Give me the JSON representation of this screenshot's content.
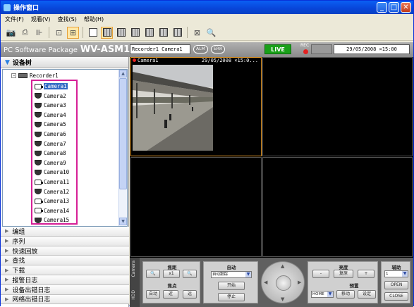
{
  "window": {
    "title": "操作窗口",
    "min_btn": "_",
    "max_btn": "□",
    "close_btn": "✕"
  },
  "menu": [
    "文件(F)",
    "观看(V)",
    "查找(S)",
    "帮助(H)"
  ],
  "infobar": {
    "brand_prefix": "PC Software Package",
    "brand_model": "WV-ASM100",
    "recorder_camera": "Recorder1 Camera1",
    "alm": "ALM",
    "err": "ERR",
    "live": "LIVE",
    "rec": "REC",
    "datetime": "29/05/2008 ×15:00"
  },
  "tree": {
    "header": "设备树",
    "recorder": "Recorder1",
    "cameras": [
      {
        "label": "Camera1",
        "type": "fixed",
        "selected": true
      },
      {
        "label": "Camera2",
        "type": "dome"
      },
      {
        "label": "Camera3",
        "type": "dome"
      },
      {
        "label": "Camera4",
        "type": "dome"
      },
      {
        "label": "Camera5",
        "type": "dome"
      },
      {
        "label": "Camera6",
        "type": "dome"
      },
      {
        "label": "Camera7",
        "type": "dome"
      },
      {
        "label": "Camera8",
        "type": "dome"
      },
      {
        "label": "Camera9",
        "type": "dome"
      },
      {
        "label": "Camera10",
        "type": "dome"
      },
      {
        "label": "Camera11",
        "type": "fixed"
      },
      {
        "label": "Camera12",
        "type": "dome"
      },
      {
        "label": "Camera13",
        "type": "fixed"
      },
      {
        "label": "Camera14",
        "type": "fixed"
      },
      {
        "label": "Camera15",
        "type": "dome"
      }
    ]
  },
  "sections": [
    "编组",
    "序列",
    "快速回放",
    "查找",
    "下载",
    "报警日志",
    "设备出错日志",
    "网络出错日志"
  ],
  "video": {
    "cam_label": "Camera1",
    "cam_time": "29/05/2008 ×15:0..."
  },
  "controls": {
    "tab_camera": "Camera",
    "tab_hdd": "HDD",
    "zoom_label": "焦距",
    "zoom_x1": "x1",
    "focus_label": "焦点",
    "focus_auto": "自动",
    "focus_near": "近",
    "focus_far": "远",
    "auto_label": "自动",
    "auto_select": "自动跟踪",
    "auto_start": "开始",
    "auto_stop": "停止",
    "brightness_label": "亮度",
    "brightness_minus": "-",
    "brightness_reset": "复原",
    "brightness_plus": "+",
    "preset_label": "预置",
    "preset_select": "HOME",
    "preset_move": "移动",
    "preset_set": "设定",
    "aux_label": "辅助",
    "aux_select": "1",
    "aux_open": "OPEN",
    "aux_close": "CLOSE"
  }
}
